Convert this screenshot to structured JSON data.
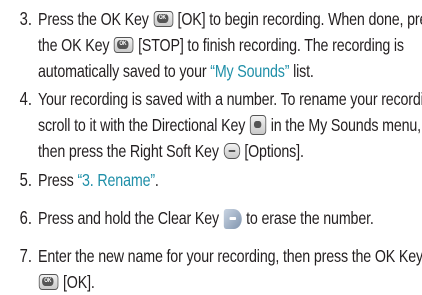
{
  "steps": [
    {
      "number": "3.",
      "lines": [
        [
          "Press the OK Key ",
          {
            "icon": "ok-key-icon"
          },
          " [OK] to begin recording. When done, press"
        ],
        [
          "the OK Key ",
          {
            "icon": "ok-key-icon"
          },
          " [STOP] to finish recording. The recording is"
        ],
        [
          "automatically saved to your ",
          {
            "hl": "“My Sounds”"
          },
          " list."
        ]
      ]
    },
    {
      "number": "4.",
      "lines": [
        [
          "Your recording is saved with a number. To rename your recording,"
        ],
        [
          "scroll to it with the Directional Key ",
          {
            "icon": "directional-key-icon"
          },
          " in the My Sounds menu,"
        ],
        [
          "then press the Right Soft Key ",
          {
            "icon": "soft-key-icon"
          },
          " [Options]."
        ]
      ]
    },
    {
      "number": "5.",
      "lines": [
        [
          "Press ",
          {
            "hl": "“3. Rename”"
          },
          "."
        ]
      ]
    },
    {
      "number": "6.",
      "lines": [
        [
          "Press and hold the Clear Key ",
          {
            "icon": "clear-key-icon"
          },
          " to erase the number."
        ]
      ]
    },
    {
      "number": "7.",
      "lines": [
        [
          "Enter the new name for your recording, then press the OK Key"
        ],
        [
          {
            "icon": "ok-key-icon"
          },
          " [OK]."
        ]
      ]
    }
  ],
  "colors": {
    "text": "#231f20",
    "highlight": "#1f8fa8"
  }
}
